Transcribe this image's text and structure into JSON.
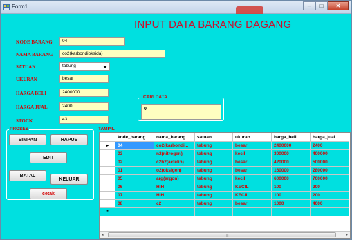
{
  "window": {
    "title": "Form1",
    "min": "–",
    "max": "□",
    "close": "✕"
  },
  "heading": "INPUT DATA BARANG DAGANG",
  "form": {
    "kode_label": "KODE BARANG",
    "kode_value": "04",
    "nama_label": "NAMA BARANG",
    "nama_value": "co2(karbondioksida)",
    "satuan_label": "SATUAN",
    "satuan_value": "tabung",
    "ukuran_label": "UKURAN",
    "ukuran_value": "besar",
    "harga_beli_label": "HARGA BELI",
    "harga_beli_value": "2400000",
    "harga_jual_label": "HARGA JUAL",
    "harga_jual_value": "2400",
    "stock_label": "STOCK",
    "stock_value": "43"
  },
  "cari": {
    "title": "CARI DATA",
    "value": "0"
  },
  "proses": {
    "title": "PROSES",
    "simpan": "SIMPAN",
    "hapus": "HAPUS",
    "edit": "EDIT",
    "batal": "BATAL",
    "keluar": "KELUAR",
    "cetak": "cetak"
  },
  "tampil": {
    "title": "TAMPIL",
    "columns": [
      "kode_barang",
      "nama_barang",
      "satuan",
      "ukuran",
      "harga_beli",
      "harga_jual"
    ],
    "rows": [
      [
        "04",
        "co2(karbondi...",
        "tabung",
        "besar",
        "2400000",
        "2400"
      ],
      [
        "03",
        "n2(nitrogen)",
        "tabung",
        "kecil",
        "300000",
        "400000"
      ],
      [
        "02",
        "c2h2(actelin)",
        "tabung",
        "besar",
        "420000",
        "500000"
      ],
      [
        "01",
        "o2(oksigen)",
        "tabung",
        "besar",
        "160000",
        "280000"
      ],
      [
        "05",
        "arg(argon)",
        "tabung",
        "kecil",
        "600000",
        "700000"
      ],
      [
        "06",
        "HIH",
        "tabung",
        "KECIL",
        "100",
        "200"
      ],
      [
        "07",
        "HIH",
        "tabung",
        "KECIL",
        "100",
        "200"
      ],
      [
        "08",
        "c2",
        "tabung",
        "besar",
        "1000",
        "4000"
      ]
    ],
    "current_marker": "▸",
    "new_marker": "*",
    "scroll_left": "◂",
    "scroll_right": "▸",
    "scroll_grip": "⦙⦙⦙"
  }
}
